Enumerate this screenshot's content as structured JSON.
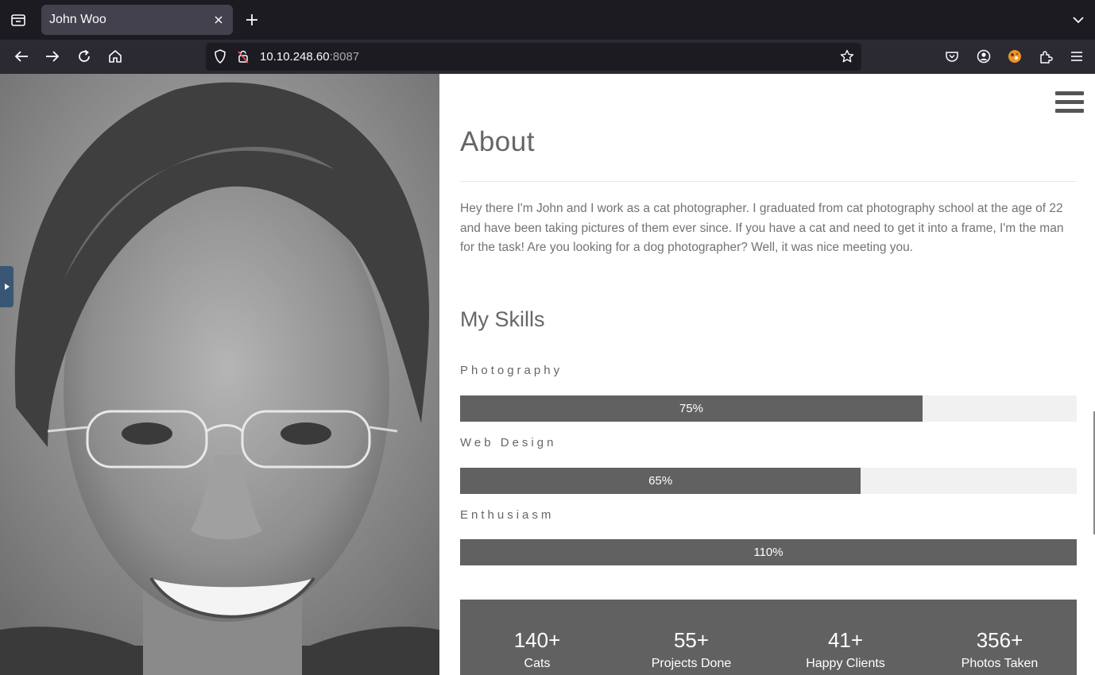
{
  "browser": {
    "tab_title": "John Woo",
    "url_host": "10.10.248.60",
    "url_port": ":8087"
  },
  "page": {
    "about_title": "About",
    "about_text": "Hey there I'm John and I work as a cat photographer. I graduated from cat photography school at the age of 22 and have been taking pictures of them ever since. If you have a cat and need to get it into a frame, I'm the man for the task! Are you looking for a dog photographer? Well, it was nice meeting you.",
    "skills_title": "My Skills",
    "skills": [
      {
        "label": "Photography",
        "percent_text": "75%",
        "fill_fraction": 0.75
      },
      {
        "label": "Web Design",
        "percent_text": "65%",
        "fill_fraction": 0.65
      },
      {
        "label": "Enthusiasm",
        "percent_text": "110%",
        "fill_fraction": 1.0
      }
    ],
    "stats": [
      {
        "number": "140+",
        "label": "Cats"
      },
      {
        "number": "55+",
        "label": "Projects Done"
      },
      {
        "number": "41+",
        "label": "Happy Clients"
      },
      {
        "number": "356+",
        "label": "Photos Taken"
      }
    ]
  },
  "icons": {
    "tab_list": "tab-list-icon",
    "close": "close-icon",
    "new_tab": "plus-icon",
    "back": "back-arrow-icon",
    "forward": "forward-arrow-icon",
    "reload": "reload-icon",
    "home": "home-icon",
    "shield": "shield-icon",
    "lock": "insecure-lock-icon",
    "bookmark": "star-icon",
    "pocket": "pocket-icon",
    "account": "account-icon",
    "extension": "extension-icon",
    "extensions_menu": "puzzle-icon",
    "menu": "hamburger-menu-icon"
  },
  "colors": {
    "skill_fill": "#616161",
    "skill_track": "#f1f1f1",
    "stats_bg": "#616161",
    "heading": "#666666",
    "browser_bg": "#1c1b22",
    "tab_active": "#42414d"
  }
}
